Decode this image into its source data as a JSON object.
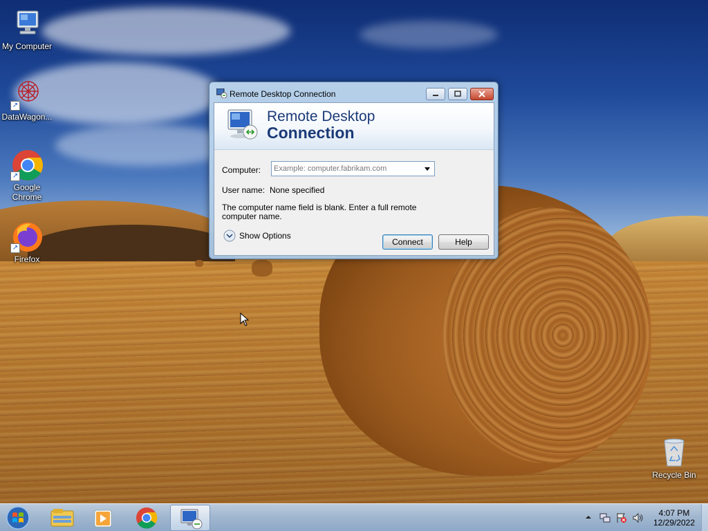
{
  "desktop": {
    "icons": [
      {
        "label": "My Computer",
        "icon": "computer-icon"
      },
      {
        "label": "DataWagon...",
        "icon": "datawagon-icon"
      },
      {
        "label": "Google\nChrome",
        "line1": "Google",
        "line2": "Chrome",
        "icon": "chrome-icon"
      },
      {
        "label": "Firefox",
        "icon": "firefox-icon"
      },
      {
        "label": "Recycle Bin",
        "icon": "recycle-bin-icon"
      }
    ]
  },
  "rdp_window": {
    "title": "Remote Desktop Connection",
    "banner_line1": "Remote Desktop",
    "banner_line2": "Connection",
    "computer_label": "Computer:",
    "computer_placeholder": "Example: computer.fabrikam.com",
    "computer_value": "",
    "username_label": "User name:",
    "username_value": "None specified",
    "message": "The computer name field is blank. Enter a full remote computer name.",
    "show_options_label": "Show Options",
    "connect_label": "Connect",
    "help_label": "Help"
  },
  "taskbar": {
    "pinned": [
      "windows-explorer-icon",
      "media-player-icon",
      "chrome-icon",
      "remote-desktop-icon"
    ],
    "active": "remote-desktop-icon",
    "clock_time": "4:07 PM",
    "clock_date": "12/29/2022"
  },
  "colors": {
    "banner_text": "#1b3a78",
    "taskbar": "#a9c2e0",
    "window_frame": "#bcd3ea"
  }
}
